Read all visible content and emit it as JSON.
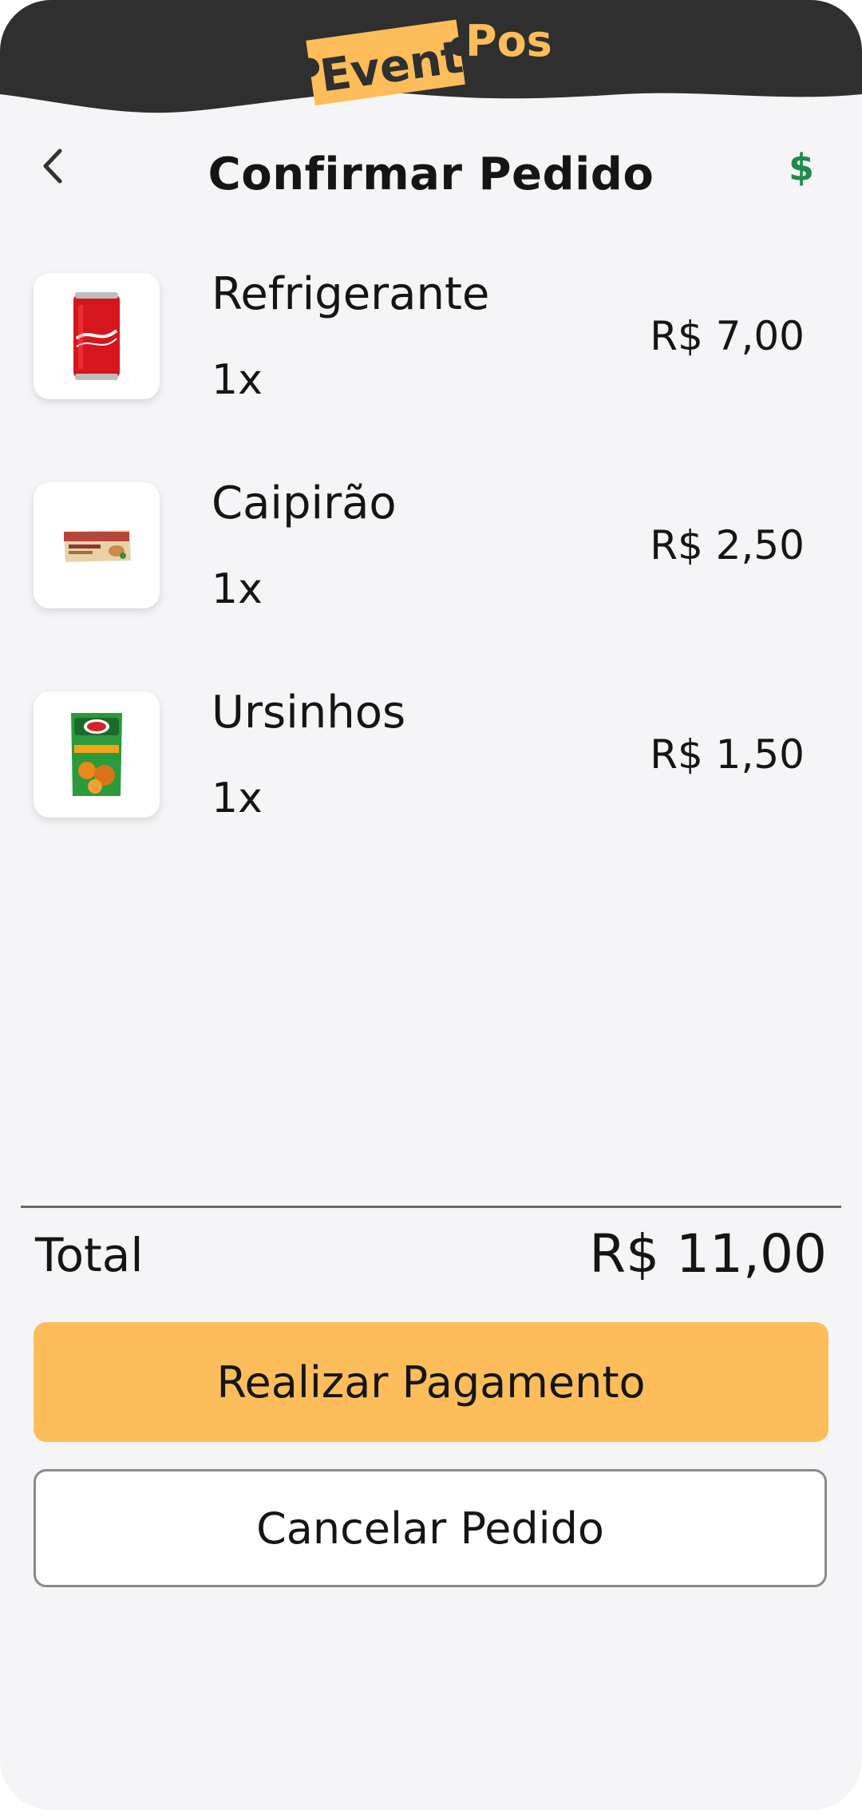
{
  "app": {
    "logo_word_1": "Event",
    "logo_word_2": "Pos"
  },
  "header": {
    "title": "Confirmar Pedido",
    "back_icon": "chevron-left-icon",
    "currency_icon": "dollar-icon",
    "currency_symbol": "$"
  },
  "order": {
    "items": [
      {
        "name": "Refrigerante",
        "quantity": "1x",
        "price": "R$ 7,00",
        "image": "soda-can-image"
      },
      {
        "name": "Caipirão",
        "quantity": "1x",
        "price": "R$ 2,50",
        "image": "snack-bar-image"
      },
      {
        "name": "Ursinhos",
        "quantity": "1x",
        "price": "R$ 1,50",
        "image": "gummy-candy-image"
      }
    ],
    "total_label": "Total",
    "total_value": "R$ 11,00"
  },
  "actions": {
    "pay_label": "Realizar Pagamento",
    "cancel_label": "Cancelar Pedido"
  },
  "colors": {
    "header_dark": "#2f2f2f",
    "accent_yellow": "#fcbd5a",
    "dollar_green": "#1f8a4c",
    "background": "#f5f5f7"
  }
}
